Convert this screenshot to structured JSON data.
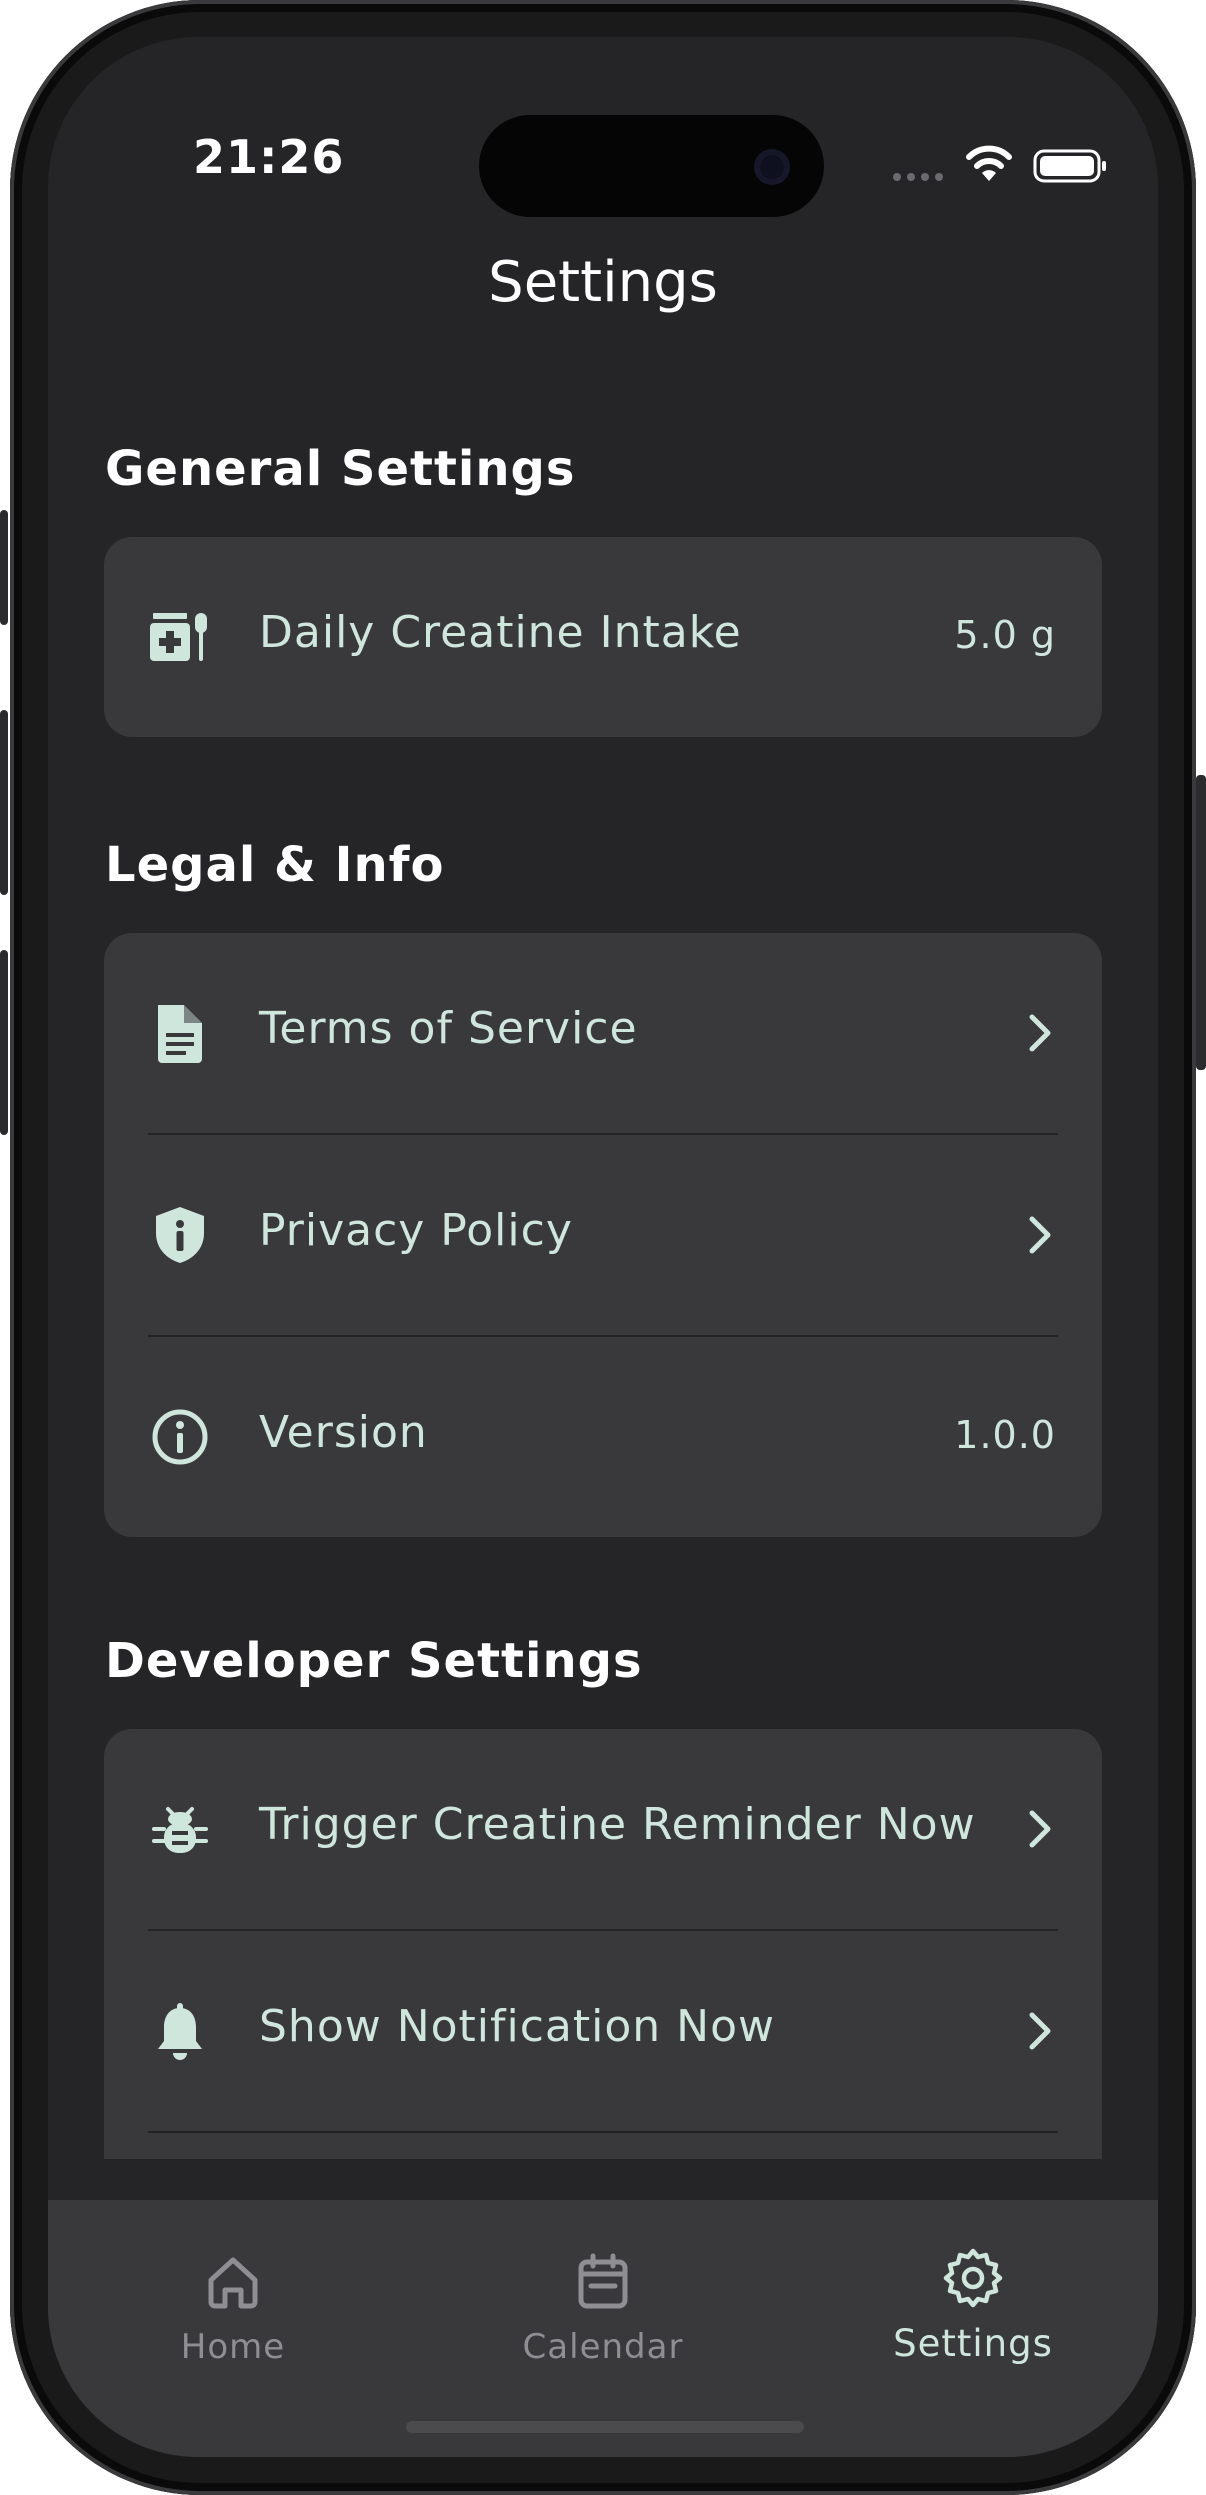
{
  "status_bar": {
    "time": "21:26"
  },
  "nav": {
    "title": "Settings"
  },
  "sections": {
    "general": {
      "title": "General Settings",
      "items": [
        {
          "label": "Daily Creatine Intake",
          "value": "5.0 g",
          "icon": "supplement-icon"
        }
      ]
    },
    "legal": {
      "title": "Legal & Info",
      "items": [
        {
          "label": "Terms of Service",
          "icon": "document-icon"
        },
        {
          "label": "Privacy Policy",
          "icon": "shield-icon"
        },
        {
          "label": "Version",
          "value": "1.0.0",
          "icon": "info-icon"
        }
      ]
    },
    "developer": {
      "title": "Developer Settings",
      "items": [
        {
          "label": "Trigger Creatine Reminder Now",
          "icon": "bug-icon"
        },
        {
          "label": "Show Notification Now",
          "icon": "bell-icon"
        }
      ]
    }
  },
  "tabbar": {
    "tabs": [
      {
        "label": "Home",
        "icon": "home-icon"
      },
      {
        "label": "Calendar",
        "icon": "calendar-icon"
      },
      {
        "label": "Settings",
        "icon": "gear-icon",
        "selected": true
      }
    ]
  },
  "colors": {
    "background": "#252527",
    "card": "#39393c",
    "accent": "#cfe6dd",
    "inactive_tab": "#8e8e93"
  }
}
